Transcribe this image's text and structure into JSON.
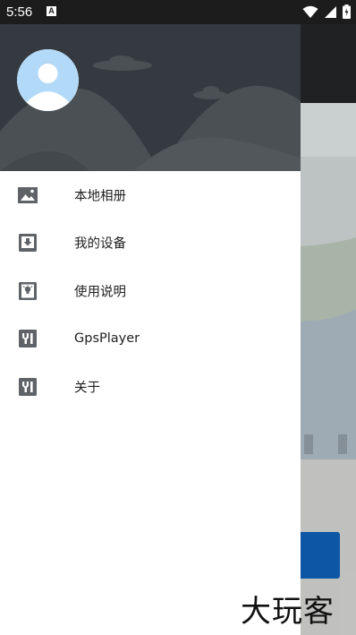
{
  "status_bar": {
    "time": "5:56",
    "notification_badge": "A",
    "icons": [
      "wifi-icon",
      "signal-icon",
      "battery-charging-icon"
    ]
  },
  "drawer": {
    "header": {
      "avatar": "avatar-placeholder"
    },
    "items": [
      {
        "label": "本地相册",
        "icon": "image-icon"
      },
      {
        "label": "我的设备",
        "icon": "download-box-icon"
      },
      {
        "label": "使用说明",
        "icon": "help-book-icon"
      },
      {
        "label": "GpsPlayer",
        "icon": "yi-logo-icon"
      },
      {
        "label": "关于",
        "icon": "yi-logo-icon"
      }
    ]
  },
  "watermark": {
    "text": "大玩客"
  },
  "colors": {
    "status_bar": "#1c1c1c",
    "drawer_header": "#353a40",
    "mountain": "#4b5055",
    "avatar_bg": "#b3d9f9",
    "icon": "#5f6368",
    "accent_button": "#0d5cb0"
  }
}
